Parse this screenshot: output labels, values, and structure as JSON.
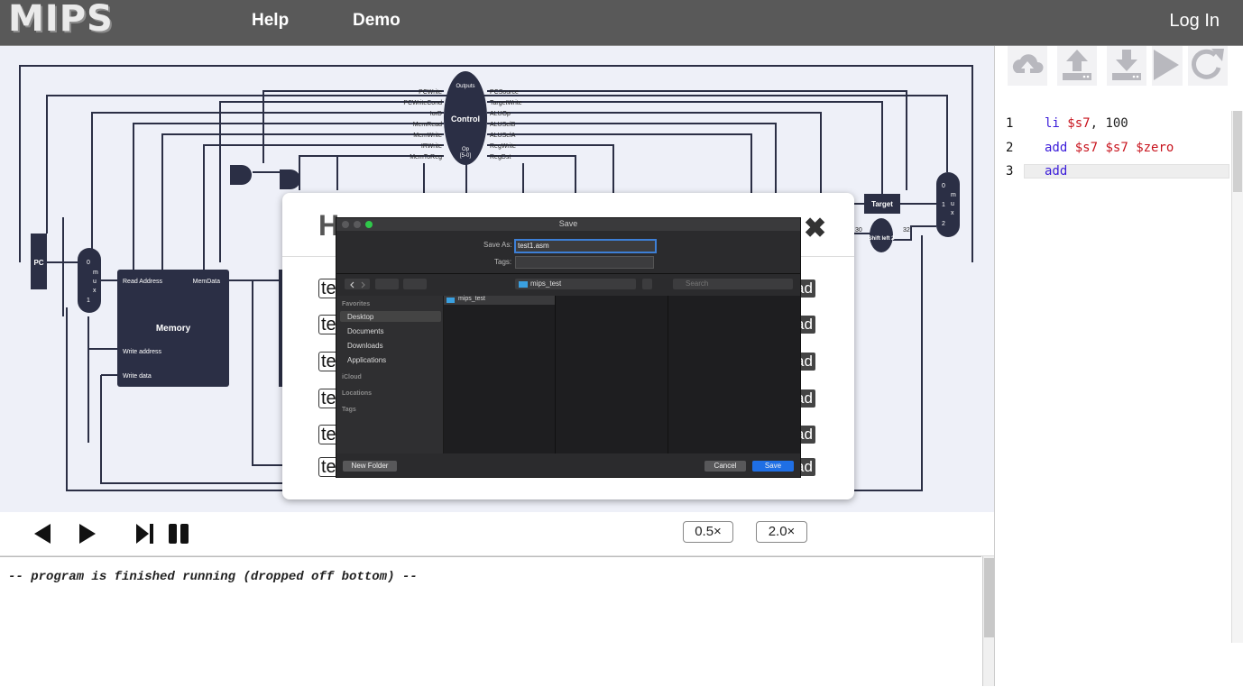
{
  "header": {
    "logo": "MIPS",
    "nav": [
      "Help",
      "Demo"
    ],
    "login": "Log In"
  },
  "diagram": {
    "control_label": "Control",
    "control_outputs": "Outputs",
    "control_op": "Op",
    "control_op_bits": "[5-0]",
    "signals_left": [
      "PCWrite",
      "PCWriteCond",
      "IorD",
      "MemRead",
      "MemWrite",
      "IRWrite",
      "MemToReg"
    ],
    "signals_right": [
      "PCSource",
      "TargetWrite",
      "ALUOp",
      "ALUSelB",
      "ALUSelA",
      "RegWrite",
      "RegDst"
    ],
    "pc_label": "PC",
    "mux1": [
      "0",
      "m",
      "u",
      "x",
      "1"
    ],
    "memory_label": "Memory",
    "memory_ports": [
      "Read Address",
      "MemData",
      "Write address",
      "Write data"
    ],
    "target_label": "Target",
    "shift_label": "Shift left 2",
    "shift_in": "30",
    "shift_out": "32",
    "mux2": [
      "0",
      "1",
      "2",
      "m",
      "u",
      "x"
    ]
  },
  "controls": {
    "speed_slow": "0.5×",
    "speed_fast": "2.0×"
  },
  "console": {
    "message": "-- program is finished running (dropped off bottom) --"
  },
  "editor": {
    "lines": [
      {
        "no": "1",
        "op": "li",
        "args": [
          {
            "t": "$s7",
            "c": "reg"
          },
          {
            "t": ", ",
            "c": "num"
          },
          {
            "t": "100",
            "c": "num"
          }
        ]
      },
      {
        "no": "2",
        "op": "add",
        "args": [
          {
            "t": "$s7",
            "c": "reg"
          },
          {
            "t": " ",
            "c": "num"
          },
          {
            "t": "$s7",
            "c": "reg"
          },
          {
            "t": " ",
            "c": "num"
          },
          {
            "t": "$zero",
            "c": "reg"
          }
        ]
      },
      {
        "no": "3",
        "op": "add",
        "args": []
      }
    ],
    "tools": [
      "cloud-upload-icon",
      "upload-icon",
      "download-icon",
      "run-icon",
      "reset-icon"
    ]
  },
  "modal": {
    "title": "H",
    "close": "✖",
    "rows": [
      {
        "left": "te",
        "right": "ad"
      },
      {
        "left": "te",
        "right": "ad"
      },
      {
        "left": "te",
        "right": "ad"
      },
      {
        "left": "te",
        "right": "ad"
      },
      {
        "left": "te",
        "right": "ad"
      },
      {
        "left": "te",
        "right": "ad"
      }
    ]
  },
  "save_dialog": {
    "title": "Save",
    "save_as_label": "Save As:",
    "save_as_value": "test1.asm",
    "tags_label": "Tags:",
    "location": "mips_test",
    "search_placeholder": "Search",
    "favorites_header": "Favorites",
    "favorites": [
      "Desktop",
      "Documents",
      "Downloads",
      "Applications"
    ],
    "icloud_header": "iCloud",
    "locations_header": "Locations",
    "tags_header": "Tags",
    "column_item": "mips_test",
    "new_folder": "New Folder",
    "cancel": "Cancel",
    "save": "Save"
  }
}
